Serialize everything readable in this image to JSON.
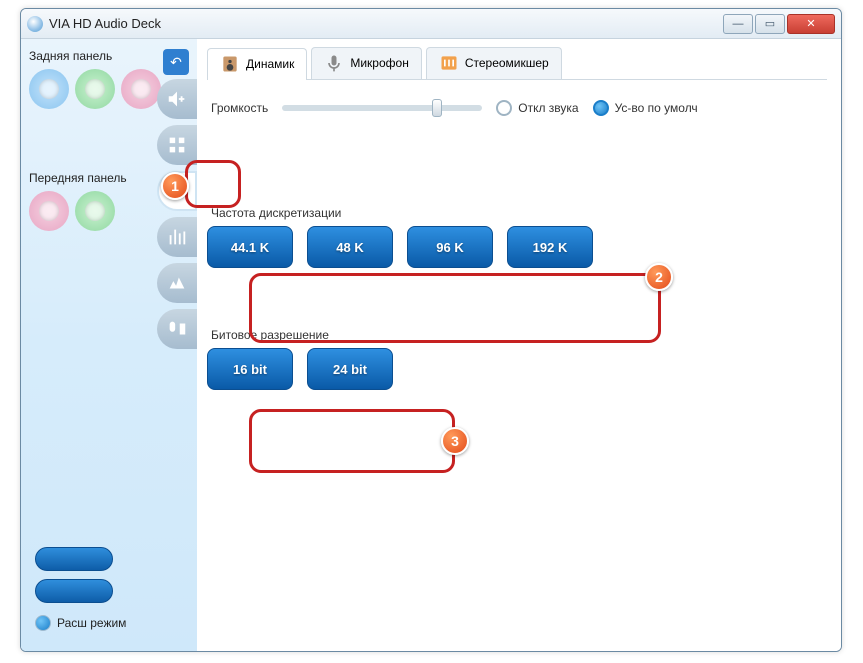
{
  "window": {
    "title": "VIA HD Audio Deck"
  },
  "sidebar": {
    "rear_label": "Задняя панель",
    "front_label": "Передняя панель",
    "mode_label": "Расш режим"
  },
  "tabs": [
    {
      "label": "Динамик",
      "icon": "speaker"
    },
    {
      "label": "Микрофон",
      "icon": "mic"
    },
    {
      "label": "Стереомикшер",
      "icon": "mixer"
    }
  ],
  "volume": {
    "label": "Громкость",
    "mute_label": "Откл звука",
    "default_label": "Ус-во по умолч"
  },
  "sample_rate": {
    "label": "Частота дискретизации",
    "options": [
      "44.1 K",
      "48 K",
      "96 K",
      "192 K"
    ]
  },
  "bit_depth": {
    "label": "Битовое разрешение",
    "options": [
      "16 bit",
      "24 bit"
    ]
  },
  "callouts": {
    "1": "1",
    "2": "2",
    "3": "3"
  }
}
